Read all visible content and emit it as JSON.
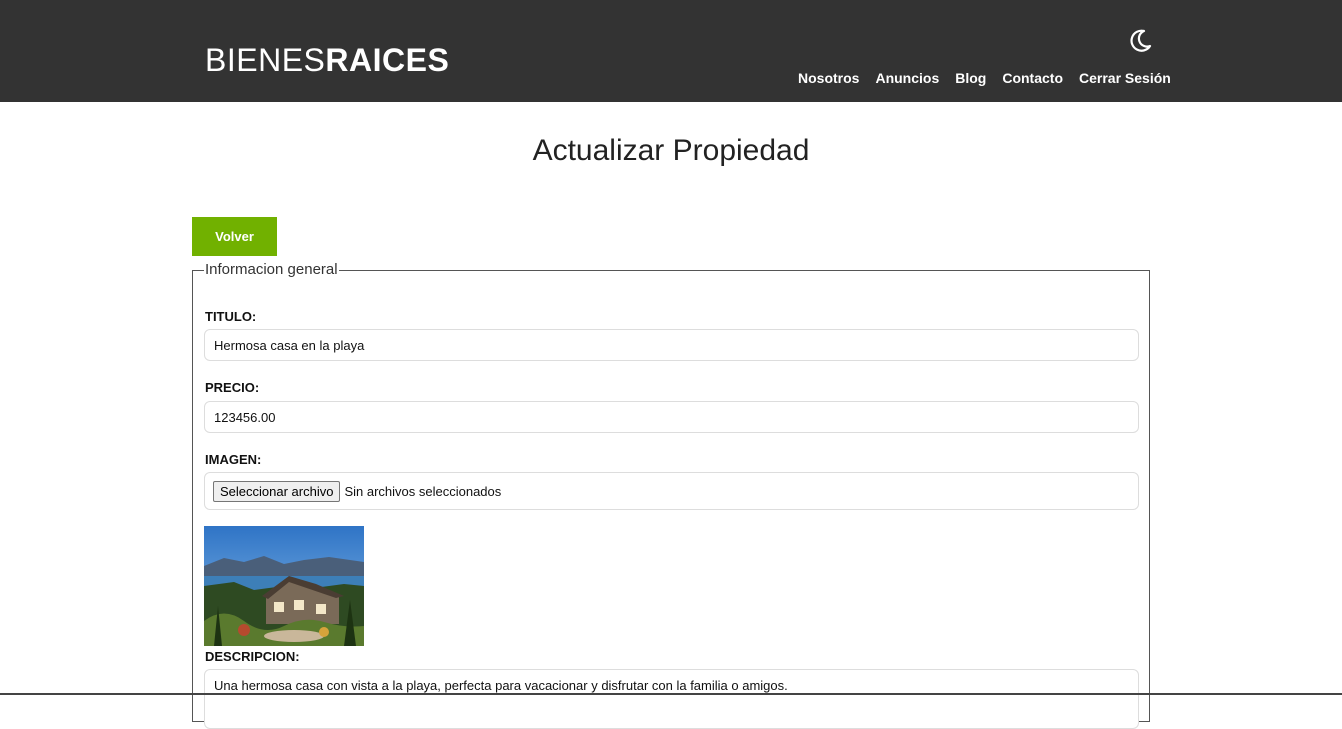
{
  "header": {
    "logo_light": "BIENES",
    "logo_bold": "RAICES",
    "nav": [
      "Nosotros",
      "Anuncios",
      "Blog",
      "Contacto",
      "Cerrar Sesión"
    ],
    "theme_icon": "moon-icon"
  },
  "main": {
    "title": "Actualizar Propiedad",
    "back_button": "Volver",
    "fieldset": {
      "legend": "Informacion general",
      "titulo_label": "TITULO:",
      "titulo_value": "Hermosa casa en la playa",
      "precio_label": "PRECIO:",
      "precio_value": "123456.00",
      "imagen_label": "IMAGEN:",
      "file_button": "Seleccionar archivo",
      "file_status": "Sin archivos seleccionados",
      "descripcion_label": "DESCRIPCION:",
      "descripcion_value": "Una hermosa casa con vista a la playa, perfecta para vacacionar y disfrutar con la familia o amigos."
    }
  },
  "colors": {
    "header_bg": "#333333",
    "accent_green": "#71b100"
  }
}
